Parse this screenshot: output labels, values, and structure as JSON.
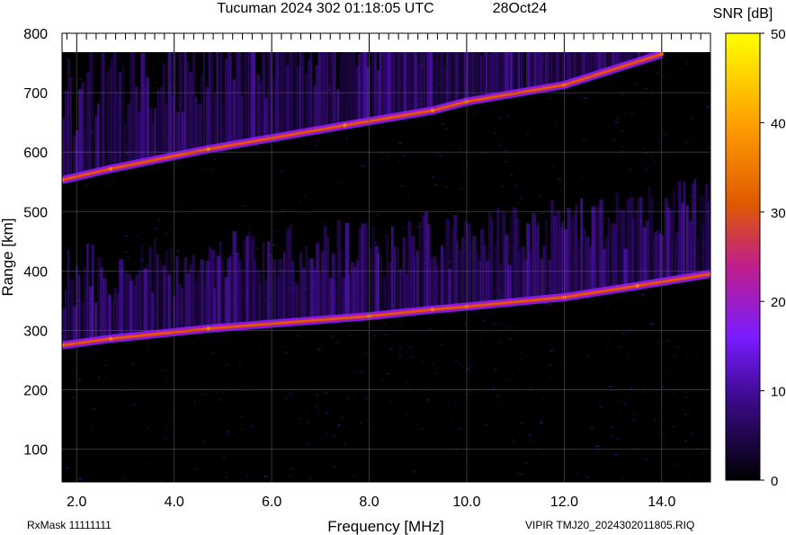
{
  "header": {
    "title": "Tucuman 2024 302 01:18:05 UTC",
    "date": "28Oct24"
  },
  "footer": {
    "rx_mask": "RxMask 11111111",
    "file_info": "VIPIR  TMJ20_2024302011805.RIQ"
  },
  "chart_data": {
    "type": "heatmap",
    "title": "Tucuman 2024 302 01:18:05 UTC",
    "xlabel": "Frequency [MHz]",
    "ylabel": "Range [km]",
    "xlim": [
      1.7,
      15.0
    ],
    "ylim": [
      45,
      800
    ],
    "x_ticks": [
      2.0,
      4.0,
      6.0,
      8.0,
      10.0,
      12.0,
      14.0
    ],
    "x_tick_labels": [
      "2.0",
      "4.0",
      "6.0",
      "8.0",
      "10.0",
      "12.0",
      "14.0"
    ],
    "y_ticks": [
      100,
      200,
      300,
      400,
      500,
      600,
      700,
      800
    ],
    "y_tick_labels": [
      "100",
      "200",
      "300",
      "400",
      "500",
      "600",
      "700",
      "800"
    ],
    "grid": true,
    "colorbar": {
      "label": "SNR [dB]",
      "range": [
        0,
        50
      ],
      "ticks": [
        0,
        10,
        20,
        30,
        40,
        50
      ],
      "tick_labels": [
        "0",
        "10",
        "20",
        "30",
        "40",
        "50"
      ],
      "colors": [
        "#000000",
        "#3a0a8a",
        "#7a1cff",
        "#c01e8a",
        "#e05a00",
        "#ffa000",
        "#ffff00"
      ]
    },
    "traces": [
      {
        "name": "",
        "x": [
          1.7,
          2.7,
          4.7,
          8.0,
          9.3,
          10.0,
          12.0,
          13.5,
          15.0
        ],
        "y": [
          275,
          286,
          303,
          324,
          335,
          340,
          356,
          375,
          395
        ],
        "peak_snr": 30
      },
      {
        "name": "",
        "x": [
          1.7,
          2.7,
          4.7,
          7.5,
          9.3,
          10.0,
          12.0,
          14.0
        ],
        "y": [
          553,
          572,
          605,
          645,
          670,
          685,
          713,
          765
        ],
        "peak_snr": 27
      }
    ]
  }
}
